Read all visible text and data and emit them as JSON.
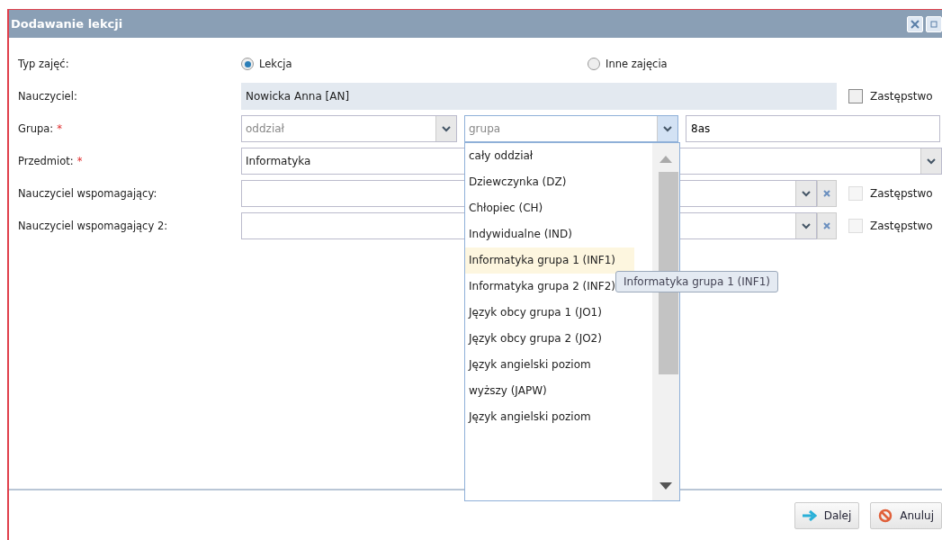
{
  "window": {
    "title": "Dodawanie lekcji"
  },
  "lesson_type": {
    "label": "Typ zajęć:",
    "options": [
      {
        "label": "Lekcja",
        "selected": true
      },
      {
        "label": "Inne zajęcia",
        "selected": false
      }
    ]
  },
  "teacher": {
    "label": "Nauczyciel:",
    "value": "Nowicka Anna [AN]",
    "substitute": {
      "label": "Zastępstwo",
      "checked": false,
      "disabled": false
    }
  },
  "group": {
    "label": "Grupa:",
    "required_mark": "*",
    "division_placeholder": "oddział",
    "group_placeholder": "grupa",
    "class_value": "8as",
    "dropdown": {
      "open": true,
      "items": [
        {
          "label": "cały oddział",
          "selected": false
        },
        {
          "label": "Dziewczynka (DZ)",
          "selected": false
        },
        {
          "label": "Chłopiec (CH)",
          "selected": false
        },
        {
          "label": "Indywidualne (IND)",
          "selected": false
        },
        {
          "label": "Informatyka grupa 1 (INF1)",
          "selected": true
        },
        {
          "label": "Informatyka grupa 2 (INF2)",
          "selected": false
        },
        {
          "label": "Język obcy grupa 1 (JO1)",
          "selected": false
        },
        {
          "label": "Język obcy grupa 2 (JO2)",
          "selected": false
        },
        {
          "label": "Język angielski poziom wyższy (JAPW)",
          "selected": false
        },
        {
          "label": "Język angielski poziom",
          "selected": false
        }
      ],
      "tooltip": "Informatyka grupa 1 (INF1)"
    }
  },
  "subject": {
    "label": "Przedmiot:",
    "required_mark": "*",
    "value": "Informatyka"
  },
  "assistants": [
    {
      "label": "Nauczyciel wspomagający:",
      "substitute": {
        "label": "Zastępstwo",
        "checked": false,
        "disabled": true
      }
    },
    {
      "label": "Nauczyciel wspomagający 2:",
      "substitute": {
        "label": "Zastępstwo",
        "checked": false,
        "disabled": true
      }
    }
  ],
  "buttons": [
    {
      "kind": "next",
      "label": "Dalej"
    },
    {
      "kind": "cancel",
      "label": "Anuluj"
    }
  ]
}
